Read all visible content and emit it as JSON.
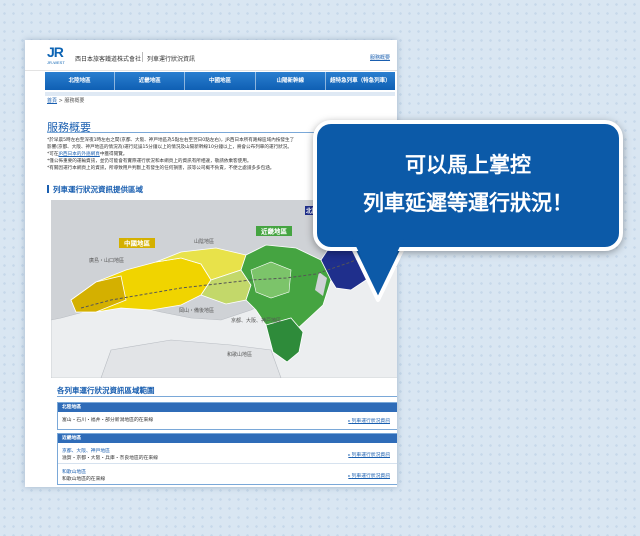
{
  "header": {
    "logo_text": "JR",
    "logo_sub": "JR-WEST",
    "company": "西日本旅客鐵道株式會社",
    "site_name": "列車運行狀況資訊",
    "help_link": "服務概要"
  },
  "nav": {
    "items": [
      "北陸地區",
      "近畿地區",
      "中國地區",
      "山陽新幹線",
      "超特急列車（特急列車）"
    ]
  },
  "breadcrumb": {
    "home": "首頁",
    "separator": ">",
    "current": "服務概要"
  },
  "page_title": "服務概要",
  "intro": {
    "lines": [
      "*於早晨5時左右至深夜1時左右之間(京都、大阪、神戸地區為5點左右至翌日0點左右)，JR西日本所有路線區域內按發生了",
      "影響(京都、大阪、神戸地區的情況為)運行延誤15分鐘以上的情況及山陽新幹線10分鐘以上，將會公布列車的運行狀況。",
      "*可在"
    ],
    "link_text": "JR西日本的外語網頁",
    "link_suffix": "中獲得閱覽。",
    "lines2": [
      "*僅公佈重要的運輸資訊，並仍可能會有實際運行狀況和本網頁上的資訊有所相違，敬請依乘客使用。",
      "*有關因運行本網頁上的資訊，所導致用戶判斷上有發生的任何損害，該等公司概不負責，不便之處請多多包涵。"
    ]
  },
  "section_map_title": "列車運行狀況資訊提供區域",
  "map": {
    "regions": {
      "hokuriku": "北陸地區",
      "kinki": "近畿地區",
      "chugoku": "中國地區",
      "sanin": "山陰地區",
      "okayama": "岡山・備後地區",
      "hiroshima": "廣島・山口地區",
      "kyoto_osaka_kobe": "京都、大阪、神戸地區",
      "wakayama": "和歌山地區"
    },
    "colors": {
      "hokuriku": "#1f2f8c",
      "kinki": "#45a441",
      "chugoku": "#f0d400",
      "chugoku_dark": "#d4b000",
      "sanin": "#e8e24a",
      "okayama": "#c3d86a",
      "sea": "#cfd2d6",
      "land": "#eceef0"
    }
  },
  "section_table_title": "各列車運行狀況資訊區域範圍",
  "tables": [
    {
      "header": "北陸地區",
      "rows": [
        {
          "region": "",
          "text": "富山・石川・福井・部分新潟地區的在來線",
          "link": "列車運行狀況資訊"
        }
      ]
    },
    {
      "header": "近畿地區",
      "rows": [
        {
          "region": "京都、大阪、神戸地區",
          "text": "滋賀・京都・大阪・兵庫・奈良地區的在來線",
          "link": "列車運行狀況資訊"
        },
        {
          "region": "和歌山地區",
          "text": "和歌山地區的在來線",
          "link": "列車運行狀況資訊"
        }
      ]
    }
  ],
  "callout": {
    "line1": "可以馬上掌控",
    "line2": "列車延遲等運行狀況！",
    "fill": "#0c5aa8"
  }
}
